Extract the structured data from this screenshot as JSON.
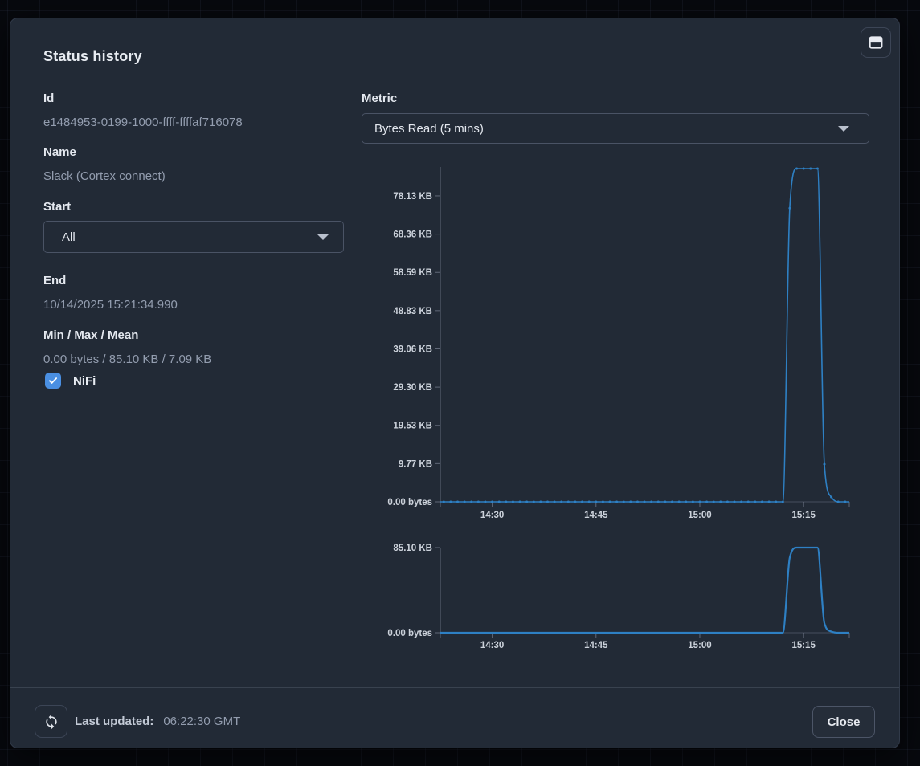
{
  "dialog": {
    "title": "Status history",
    "fields": {
      "id": {
        "label": "Id",
        "value": "e1484953-0199-1000-ffff-ffffaf716078"
      },
      "name": {
        "label": "Name",
        "value": "Slack (Cortex connect)"
      },
      "start": {
        "label": "Start",
        "value": "All"
      },
      "end": {
        "label": "End",
        "value": "10/14/2025 15:21:34.990"
      },
      "min_max_mean": {
        "label": "Min / Max / Mean",
        "value": "0.00 bytes / 85.10 KB / 7.09 KB"
      },
      "metric": {
        "label": "Metric",
        "value": "Bytes Read (5 mins)"
      }
    },
    "legend": {
      "nifi": {
        "label": "NiFi",
        "checked": true
      }
    },
    "footer": {
      "last_updated_label": "Last updated:",
      "last_updated_value": "06:22:30 GMT",
      "close_label": "Close"
    }
  },
  "colors": {
    "page_bg": "#07090e",
    "dialog_bg": "#222a36",
    "line_blue": "#2e80c4",
    "checkbox_blue": "#4a8fe2",
    "axis": "#8a93a5",
    "tick_text": "#ccd2db"
  },
  "icons": {
    "maximize": "window-maximize-icon",
    "refresh": "refresh-icon",
    "chevron": "chevron-down-icon",
    "check": "check-icon"
  },
  "chart_data": {
    "type": "line",
    "title": "Bytes Read (5 mins) over time",
    "legend_position": "left-panel-checkbox",
    "grid": false,
    "x_axis": {
      "unit": "time-of-day",
      "domain_minutes": [
        862.5,
        921.6
      ],
      "ticks": [
        {
          "minutes": 870,
          "label": "14:30"
        },
        {
          "minutes": 885,
          "label": "14:45"
        },
        {
          "minutes": 900,
          "label": "15:00"
        },
        {
          "minutes": 915,
          "label": "15:15"
        }
      ]
    },
    "main_chart": {
      "y_domain_kb": [
        0,
        85.5
      ],
      "y_ticks": [
        {
          "kb": 78.13,
          "label": "78.13 KB"
        },
        {
          "kb": 68.36,
          "label": "68.36 KB"
        },
        {
          "kb": 58.59,
          "label": "58.59 KB"
        },
        {
          "kb": 48.83,
          "label": "48.83 KB"
        },
        {
          "kb": 39.06,
          "label": "39.06 KB"
        },
        {
          "kb": 29.3,
          "label": "29.30 KB"
        },
        {
          "kb": 19.53,
          "label": "19.53 KB"
        },
        {
          "kb": 9.77,
          "label": "9.77 KB"
        },
        {
          "kb": 0,
          "label": "0.00 bytes"
        }
      ]
    },
    "brush_chart": {
      "y_domain_kb": [
        0,
        85.1
      ],
      "y_ticks": [
        {
          "kb": 85.1,
          "label": "85.10 KB"
        },
        {
          "kb": 0,
          "label": "0.00 bytes"
        }
      ]
    },
    "series": [
      {
        "name": "NiFi",
        "color": "#2e80c4",
        "stats": {
          "min": "0.00 bytes",
          "max": "85.10 KB",
          "mean": "7.09 KB"
        },
        "points_time_kb": [
          [
            862.5,
            0
          ],
          [
            863,
            0
          ],
          [
            864,
            0
          ],
          [
            865,
            0
          ],
          [
            866,
            0
          ],
          [
            867,
            0
          ],
          [
            868,
            0
          ],
          [
            869,
            0
          ],
          [
            870,
            0
          ],
          [
            871,
            0
          ],
          [
            872,
            0
          ],
          [
            873,
            0
          ],
          [
            874,
            0
          ],
          [
            875,
            0
          ],
          [
            876,
            0
          ],
          [
            877,
            0
          ],
          [
            878,
            0
          ],
          [
            879,
            0
          ],
          [
            880,
            0
          ],
          [
            881,
            0
          ],
          [
            882,
            0
          ],
          [
            883,
            0
          ],
          [
            884,
            0
          ],
          [
            885,
            0
          ],
          [
            886,
            0
          ],
          [
            887,
            0
          ],
          [
            888,
            0
          ],
          [
            889,
            0
          ],
          [
            890,
            0
          ],
          [
            891,
            0
          ],
          [
            892,
            0
          ],
          [
            893,
            0
          ],
          [
            894,
            0
          ],
          [
            895,
            0
          ],
          [
            896,
            0
          ],
          [
            897,
            0
          ],
          [
            898,
            0
          ],
          [
            899,
            0
          ],
          [
            900,
            0
          ],
          [
            901,
            0
          ],
          [
            902,
            0
          ],
          [
            903,
            0
          ],
          [
            904,
            0
          ],
          [
            905,
            0
          ],
          [
            906,
            0
          ],
          [
            907,
            0
          ],
          [
            908,
            0
          ],
          [
            909,
            0
          ],
          [
            910,
            0
          ],
          [
            911,
            0
          ],
          [
            912,
            0
          ],
          [
            913,
            75.0
          ],
          [
            914,
            85.1
          ],
          [
            915,
            85.1
          ],
          [
            916,
            85.1
          ],
          [
            917,
            85.1
          ],
          [
            918,
            9.6
          ],
          [
            919,
            1.2
          ],
          [
            920,
            0
          ],
          [
            921,
            0
          ],
          [
            921.6,
            0
          ]
        ]
      }
    ]
  }
}
